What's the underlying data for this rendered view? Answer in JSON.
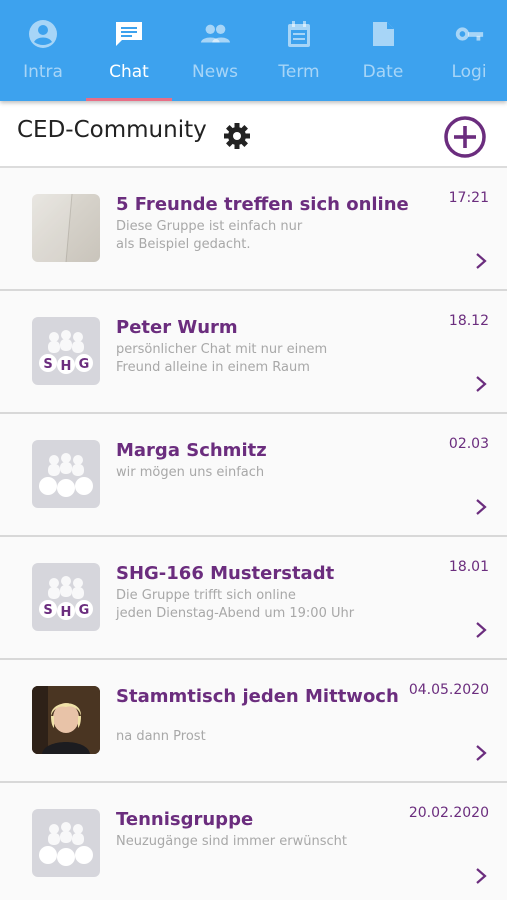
{
  "colors": {
    "topbar": "#3da2ee",
    "accent": "#6b2d7e",
    "tab_indicator": "#e86e86"
  },
  "tabs": [
    {
      "label": "Intra",
      "icon": "account-circle-icon",
      "active": false
    },
    {
      "label": "Chat",
      "icon": "chat-icon",
      "active": true
    },
    {
      "label": "News",
      "icon": "people-icon",
      "active": false
    },
    {
      "label": "Term",
      "icon": "calendar-icon",
      "active": false
    },
    {
      "label": "Date",
      "icon": "file-icon",
      "active": false
    },
    {
      "label": "Logi",
      "icon": "key-icon",
      "active": false
    }
  ],
  "header": {
    "title": "CED-Community",
    "settings_icon": "gear-icon",
    "add_icon": "add-circle-icon"
  },
  "chats": [
    {
      "name": "5 Freunde treffen sich online",
      "desc1": "Diese Gruppe ist einfach nur",
      "desc2": "als Beispiel gedacht.",
      "time": "17:21",
      "avatar": "photo-wall"
    },
    {
      "name": "Peter Wurm",
      "desc1": "persönlicher Chat mit nur einem",
      "desc2": "Freund alleine in einem Raum",
      "time": "18.12",
      "avatar": "shg-group-icon"
    },
    {
      "name": "Marga Schmitz",
      "desc1": "wir mögen uns einfach",
      "desc2": "",
      "time": "02.03",
      "avatar": "group-icon"
    },
    {
      "name": "SHG-166 Musterstadt",
      "desc1": "Die Gruppe trifft sich online",
      "desc2": "jeden Dienstag-Abend um 19:00 Uhr",
      "time": "18.01",
      "avatar": "shg-group-icon"
    },
    {
      "name": "Stammtisch jeden Mittwoch",
      "desc1": "",
      "desc2": "na dann Prost",
      "time": "04.05.2020",
      "avatar": "photo-person"
    },
    {
      "name": "Tennisgruppe",
      "desc1": "Neuzugänge sind immer erwünscht",
      "desc2": "",
      "time": "20.02.2020",
      "avatar": "group-icon"
    }
  ]
}
